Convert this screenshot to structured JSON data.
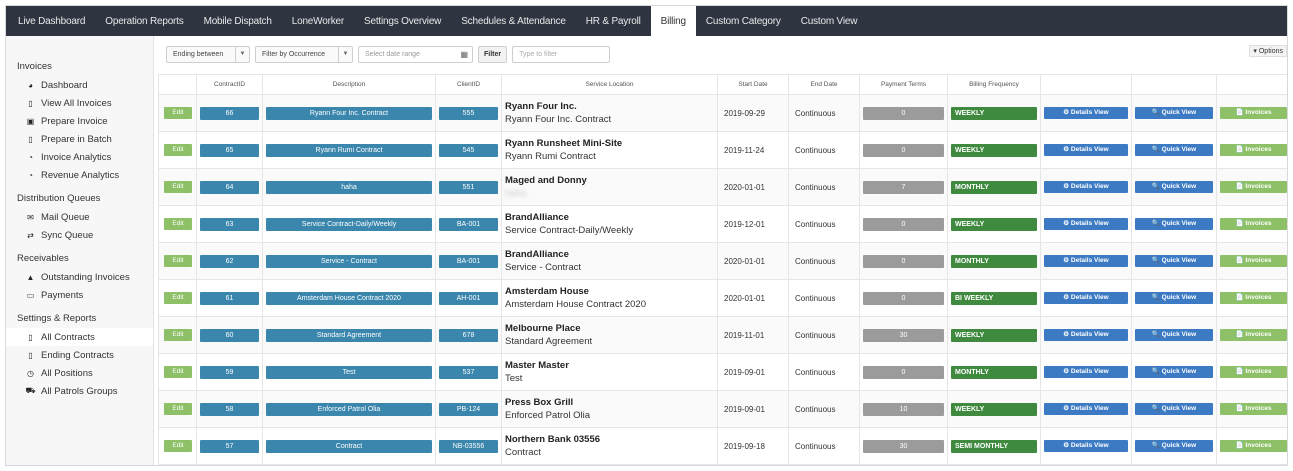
{
  "topnav": {
    "tabs": [
      "Live Dashboard",
      "Operation Reports",
      "Mobile Dispatch",
      "LoneWorker",
      "Settings Overview",
      "Schedules & Attendance",
      "HR & Payroll",
      "Billing",
      "Custom Category",
      "Custom View"
    ],
    "active": "Billing"
  },
  "sidebar": {
    "invoices_title": "Invoices",
    "invoices_items": [
      {
        "label": "Dashboard",
        "icon": "dashboard-icon",
        "glyph": "◕"
      },
      {
        "label": "View All Invoices",
        "icon": "document-icon",
        "glyph": "▯"
      },
      {
        "label": "Prepare Invoice",
        "icon": "prepare-invoice-icon",
        "glyph": "▣"
      },
      {
        "label": "Prepare in Batch",
        "icon": "document-icon",
        "glyph": "▯"
      },
      {
        "label": "Invoice Analytics",
        "icon": "pie-chart-icon",
        "glyph": "◔"
      },
      {
        "label": "Revenue Analytics",
        "icon": "pie-chart-icon",
        "glyph": "◔"
      }
    ],
    "distribution_title": "Distribution Queues",
    "distribution_items": [
      {
        "label": "Mail Queue",
        "icon": "envelope-icon",
        "glyph": "✉"
      },
      {
        "label": "Sync Queue",
        "icon": "sync-arrows-icon",
        "glyph": "⇄"
      }
    ],
    "receivables_title": "Receivables",
    "receivables_items": [
      {
        "label": "Outstanding Invoices",
        "icon": "warning-icon",
        "glyph": "▲"
      },
      {
        "label": "Payments",
        "icon": "credit-card-icon",
        "glyph": "▭"
      }
    ],
    "settings_title": "Settings & Reports",
    "settings_items": [
      {
        "label": "All Contracts",
        "icon": "document-icon",
        "glyph": "▯",
        "active": true
      },
      {
        "label": "Ending Contracts",
        "icon": "document-icon",
        "glyph": "▯"
      },
      {
        "label": "All Positions",
        "icon": "clock-icon",
        "glyph": "◷"
      },
      {
        "label": "All Patrols Groups",
        "icon": "car-icon",
        "glyph": "⛟"
      }
    ]
  },
  "toolbar": {
    "ending_between": "Ending between",
    "filter_occurrence": "Filter by Occurrence",
    "date_placeholder": "Select date range",
    "filter_label": "Filter",
    "type_placeholder": "Type to filter",
    "options_label": "▾ Options"
  },
  "table": {
    "headers": [
      "",
      "ContractID",
      "Description",
      "ClientID",
      "Service Location",
      "Start Date",
      "End Date",
      "Payment Terms",
      "Billing Frequency",
      "",
      "",
      ""
    ],
    "edit_label": "Edit",
    "details_label": "⚙ Details View",
    "quick_label": "🔍 Quick View",
    "invoices_label": "📄 Invoices",
    "rows": [
      {
        "id": "66",
        "desc": "Ryann Four Inc. Contract",
        "client": "555",
        "loc_name": "Ryann Four Inc.",
        "loc_sub": "Ryann Four Inc. Contract",
        "start": "2019-09-29",
        "end": "Continuous",
        "terms": "0",
        "freq": "WEEKLY"
      },
      {
        "id": "65",
        "desc": "Ryann Rumi Contract",
        "client": "545",
        "loc_name": "Ryann Runsheet Mini-Site",
        "loc_sub": "Ryann Rumi Contract",
        "start": "2019-11-24",
        "end": "Continuous",
        "terms": "0",
        "freq": "WEEKLY"
      },
      {
        "id": "64",
        "desc": "haha",
        "client": "551",
        "loc_name": "Maged and Donny",
        "loc_sub": "haha",
        "loc_blur": true,
        "start": "2020-01-01",
        "end": "Continuous",
        "terms": "7",
        "freq": "MONTHLY"
      },
      {
        "id": "63",
        "desc": "Service Contract-Daily/Weekly",
        "client": "BA-001",
        "loc_name": "BrandAlliance",
        "loc_sub": "Service Contract-Daily/Weekly",
        "start": "2019-12-01",
        "end": "Continuous",
        "terms": "0",
        "freq": "WEEKLY"
      },
      {
        "id": "62",
        "desc": "Service - Contract",
        "client": "BA-001",
        "loc_name": "BrandAlliance",
        "loc_sub": "Service - Contract",
        "start": "2020-01-01",
        "end": "Continuous",
        "terms": "0",
        "freq": "MONTHLY"
      },
      {
        "id": "61",
        "desc": "Amsterdam House Contract 2020",
        "client": "AH-001",
        "loc_name": "Amsterdam House",
        "loc_sub": "Amsterdam House Contract 2020",
        "start": "2020-01-01",
        "end": "Continuous",
        "terms": "0",
        "freq": "BI WEEKLY"
      },
      {
        "id": "60",
        "desc": "Standard Agreement",
        "client": "678",
        "loc_name": "Melbourne Place",
        "loc_sub": "Standard Agreement",
        "start": "2019-11-01",
        "end": "Continuous",
        "terms": "30",
        "freq": "WEEKLY"
      },
      {
        "id": "59",
        "desc": "Test",
        "client": "537",
        "loc_name": "Master Master",
        "loc_sub": "Test",
        "start": "2019-09-01",
        "end": "Continuous",
        "terms": "0",
        "freq": "MONTHLY"
      },
      {
        "id": "58",
        "desc": "Enforced Patrol Olia",
        "client": "PB-124",
        "loc_name": "Press Box Grill",
        "loc_sub": "Enforced Patrol Olia",
        "start": "2019-09-01",
        "end": "Continuous",
        "terms": "10",
        "freq": "WEEKLY"
      },
      {
        "id": "57",
        "desc": "Contract",
        "client": "NB-03556",
        "loc_name": "Northern Bank 03556",
        "loc_sub": "Contract",
        "start": "2019-09-18",
        "end": "Continuous",
        "terms": "30",
        "freq": "SEMI MONTHLY"
      }
    ]
  }
}
